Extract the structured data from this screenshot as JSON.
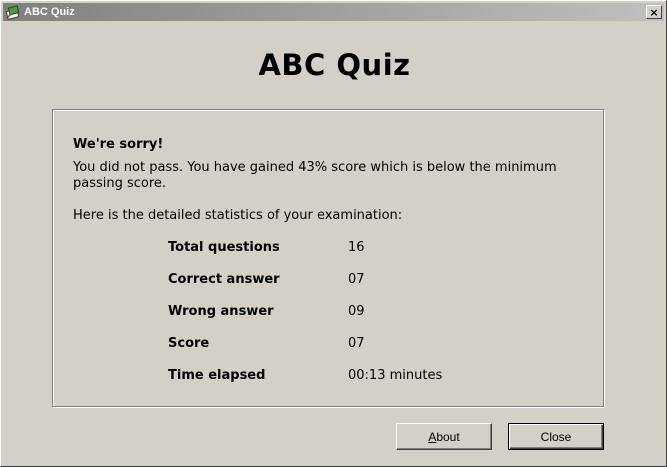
{
  "window": {
    "title": "ABC Quiz",
    "close_glyph": "×"
  },
  "header": {
    "app_title": "ABC Quiz"
  },
  "result": {
    "heading": "We're sorry!",
    "message": "You did not pass. You have gained 43% score which is below the minimum passing score.",
    "stats_intro": "Here is the detailed statistics of your examination:",
    "stats": [
      {
        "label": "Total questions",
        "value": "16"
      },
      {
        "label": "Correct answer",
        "value": "07"
      },
      {
        "label": "Wrong answer",
        "value": "09"
      },
      {
        "label": "Score",
        "value": "07"
      },
      {
        "label": "Time elapsed",
        "value": "00:13 minutes"
      }
    ]
  },
  "buttons": {
    "about_mnemonic": "A",
    "about_rest": "bout",
    "close_label": "Close"
  },
  "icons": {
    "app": "quiz-app-icon",
    "close": "close-icon"
  },
  "colors": {
    "face": "#d4d0c8",
    "titlebar_start": "#808080",
    "titlebar_end": "#c0c0c0"
  }
}
